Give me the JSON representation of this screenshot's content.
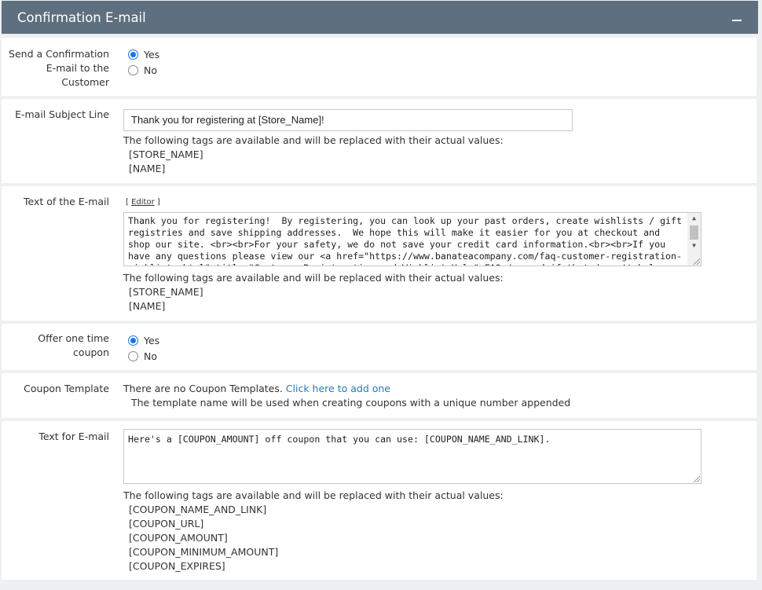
{
  "panel": {
    "title": "Confirmation E-mail"
  },
  "confirmation": {
    "label": [
      "Send a Confirmation",
      "E-mail to the",
      "Customer"
    ],
    "options": [
      "Yes",
      "No"
    ],
    "selected": "Yes"
  },
  "subject": {
    "label": "E-mail Subject Line",
    "value": "Thank you for registering at  [Store_Name]!",
    "help": "The following tags are available and will be replaced with their actual values:",
    "tags": [
      "[STORE_NAME]",
      "[NAME]"
    ]
  },
  "body_text": {
    "label": "Text of the E-mail",
    "editor_prefix": "[ ",
    "editor_link": "Editor",
    "editor_suffix": " ]",
    "value": "Thank you for registering!  By registering, you can look up your past orders, create wishlists / gift registries and save shipping addresses.  We hope this will make it easier for you at checkout and shop our site. <br><br>For your safety, we do not save your credit card information.<br><br>If you have any questions please view our <a href=\"https://www.banateacompany.com/faq-customer-registration-wishlists.html\" title=\"Customer Registeration and Wishlist Help\">FAQ</a> and if that doesn't help please",
    "help": "The following tags are available and will be replaced with their actual values:",
    "tags": [
      "[STORE_NAME]",
      "[NAME]"
    ]
  },
  "coupon_offer": {
    "label": [
      "Offer one time",
      "coupon"
    ],
    "options": [
      "Yes",
      "No"
    ],
    "selected": "Yes"
  },
  "coupon_template": {
    "label": "Coupon Template",
    "text": "There are no Coupon Templates.",
    "link": "Click here to add one",
    "note": "The template name will be used when creating coupons with a unique number appended"
  },
  "coupon_email": {
    "label": "Text for E-mail",
    "value": "Here's a [COUPON_AMOUNT] off coupon that you can use: [COUPON_NAME_AND_LINK].",
    "help": "The following tags are available and will be replaced with their actual values:",
    "tags": [
      "[COUPON_NAME_AND_LINK]",
      "[COUPON_URL]",
      "[COUPON_AMOUNT]",
      "[COUPON_MINIMUM_AMOUNT]",
      "[COUPON_EXPIRES]"
    ]
  }
}
